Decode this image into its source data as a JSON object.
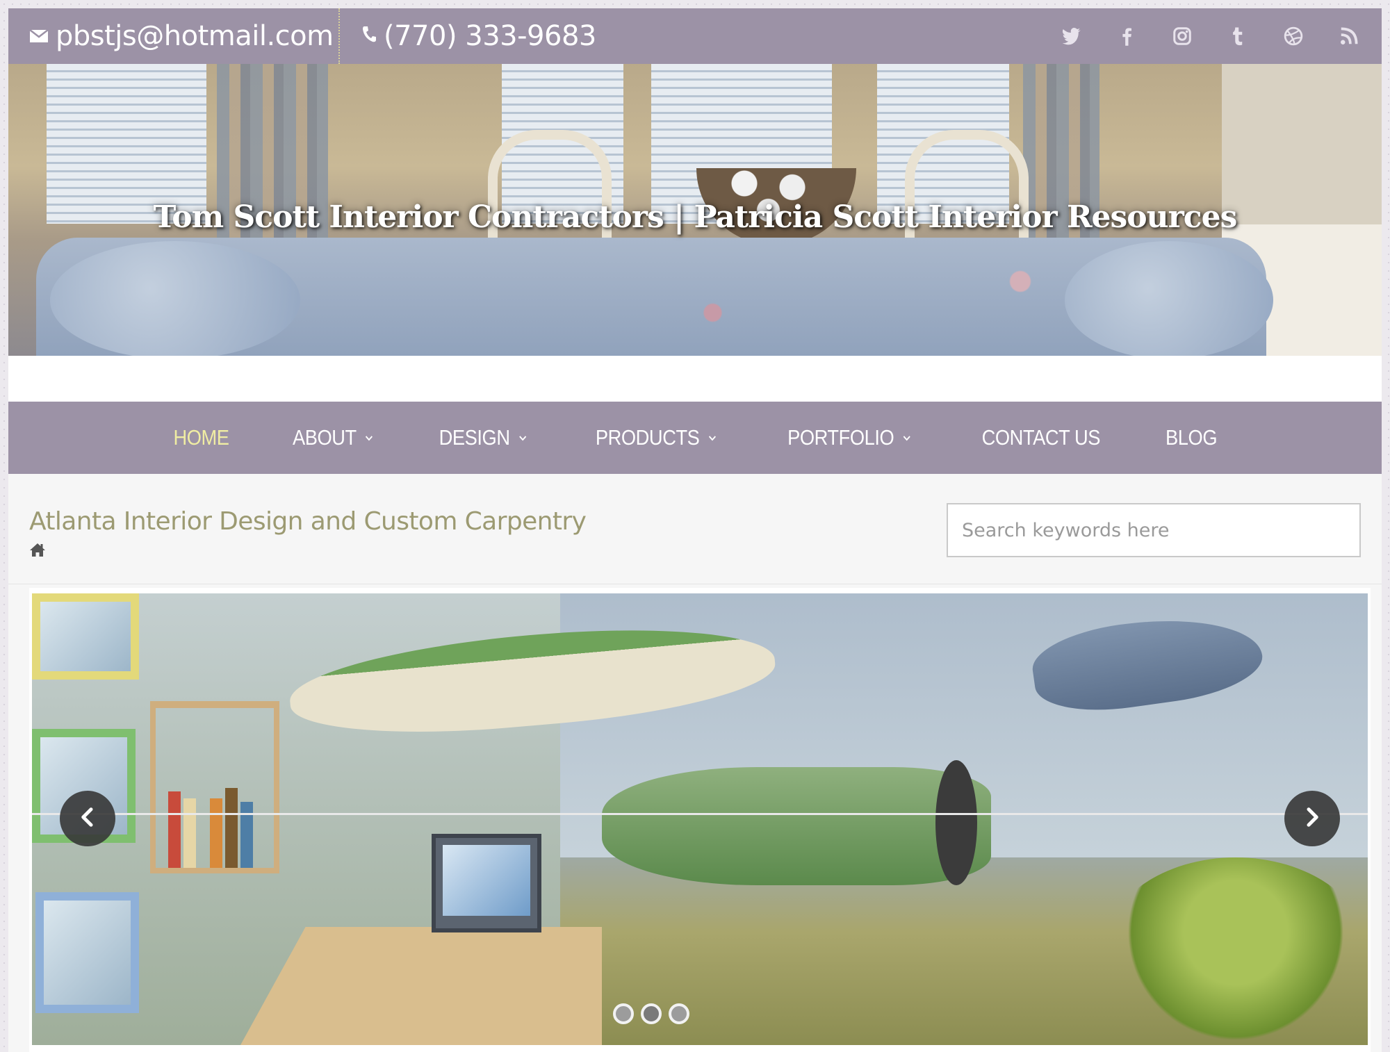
{
  "topbar": {
    "email": "pbstjs@hotmail.com",
    "phone": "(770) 333-9683",
    "email_icon": "envelope-icon",
    "phone_icon": "phone-icon",
    "social": [
      "twitter-icon",
      "facebook-icon",
      "instagram-icon",
      "tumblr-icon",
      "dribbble-icon",
      "rss-icon"
    ]
  },
  "hero": {
    "title": "Tom Scott Interior Contractors | Patricia Scott Interior Resources"
  },
  "nav": {
    "items": [
      {
        "label": "HOME",
        "active": true,
        "dropdown": false
      },
      {
        "label": "ABOUT",
        "active": false,
        "dropdown": true
      },
      {
        "label": "DESIGN",
        "active": false,
        "dropdown": true
      },
      {
        "label": "PRODUCTS",
        "active": false,
        "dropdown": true
      },
      {
        "label": "PORTFOLIO",
        "active": false,
        "dropdown": true
      },
      {
        "label": "CONTACT US",
        "active": false,
        "dropdown": false
      },
      {
        "label": "BLOG",
        "active": false,
        "dropdown": false
      }
    ],
    "caret": "⌄"
  },
  "page": {
    "title": "Atlanta Interior Design and Custom Carpentry",
    "breadcrumb_icon": "home-icon"
  },
  "search": {
    "placeholder": "Search keywords here",
    "value": ""
  },
  "slider": {
    "slide_count": 3,
    "active_index": 1
  },
  "colors": {
    "bar": "#9c92a6",
    "active_nav": "#f0eda3",
    "title": "#9c9a72"
  }
}
